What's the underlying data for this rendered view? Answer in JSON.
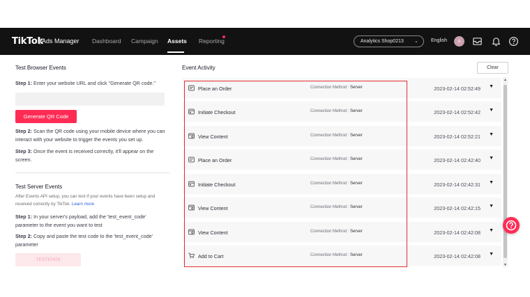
{
  "topbar": {
    "brand": "TikTok",
    "brand_sub": "Ads Manager",
    "nav": [
      "Dashboard",
      "Campaign",
      "Assets",
      "Reporting"
    ],
    "active_nav": "Assets",
    "account": "Analytics Shop0213",
    "language": "English",
    "avatar_letter": "u"
  },
  "left": {
    "browser_title": "Test Browser Events",
    "step1_prefix": "Step 1:",
    "step1_text": " Enter your website URL and click \"Generate QR code.\"",
    "url_placeholder": "",
    "generate_button": "Generate QR Code",
    "step2_prefix": "Step 2:",
    "step2_text": " Scan the QR code using your mobile device where you can interact with your website to trigger the events you set up.",
    "step3_prefix": "Step 3:",
    "step3_text": " Once the event is received correctly, it'll appear on the screen.",
    "server_title": "Test Server Events",
    "server_desc": "After Events API setup, you can test if your events have been setup and received correctly by TikTok.",
    "learn_more": "Learn more",
    "s_step1_prefix": "Step 1:",
    "s_step1_text": " In your server's payload, add the 'test_event_code' parameter to the event you want to test",
    "s_step2_prefix": "Step 2:",
    "s_step2_text": " Copy and paste the test code to the 'test_event_code' parameter",
    "test_code": "TEST97429"
  },
  "right": {
    "title": "Event Activity",
    "clear_button": "Clear",
    "method_label": "Connection Method : ",
    "events": [
      {
        "name": "Place an Order",
        "method": "Server",
        "time": "2023-02-14 02:52:49",
        "icon": "order-icon"
      },
      {
        "name": "Initiate Checkout",
        "method": "Server",
        "time": "2023-02-14 02:52:42",
        "icon": "checkout-icon"
      },
      {
        "name": "View Content",
        "method": "Server",
        "time": "2023-02-14 02:52:21",
        "icon": "view-content-icon"
      },
      {
        "name": "Place an Order",
        "method": "Server",
        "time": "2023-02-14 02:42:40",
        "icon": "order-icon"
      },
      {
        "name": "Initiate Checkout",
        "method": "Server",
        "time": "2023-02-14 02:42:31",
        "icon": "checkout-icon"
      },
      {
        "name": "View Content",
        "method": "Server",
        "time": "2023-02-14 02:42:15",
        "icon": "view-content-icon"
      },
      {
        "name": "View Content",
        "method": "Server",
        "time": "2023-02-14 02:42:08",
        "icon": "view-content-icon"
      },
      {
        "name": "Add to Cart",
        "method": "Server",
        "time": "2023-02-14 02:42:08",
        "icon": "cart-icon"
      }
    ]
  },
  "colors": {
    "accent": "#fe2c55",
    "topbar": "#121212",
    "highlight": "#e02d2d"
  }
}
